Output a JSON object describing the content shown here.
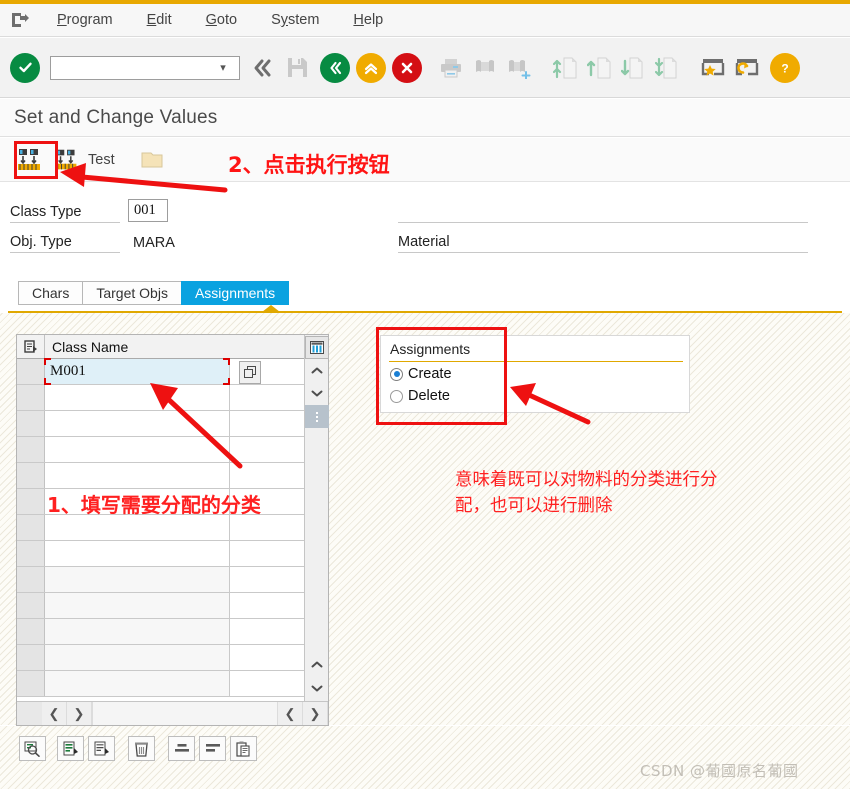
{
  "window": {
    "icon": "window-exit-icon",
    "accent_gold": "#e8a800"
  },
  "menubar": {
    "items": [
      {
        "label": "Program"
      },
      {
        "label": "Edit"
      },
      {
        "label": "Goto"
      },
      {
        "label": "System"
      },
      {
        "label": "Help"
      }
    ]
  },
  "system_toolbar": {
    "command_field": {
      "value": "",
      "placeholder": ""
    },
    "icons": [
      "enter-checkmark-icon",
      "back-double-chevron-icon",
      "save-disk-icon",
      "back-green-icon",
      "exit-up-icon",
      "cancel-x-icon",
      "print-icon",
      "find-icon",
      "find-next-icon",
      "first-page-icon",
      "previous-page-icon",
      "next-page-icon",
      "last-page-icon",
      "create-favorite-icon",
      "customize-local-layout-icon",
      "help-icon"
    ]
  },
  "title": {
    "text": "Set and Change Values"
  },
  "app_toolbar": {
    "execute_button": "execute-icon",
    "test_button_label": "Test",
    "folder_button": "folder-icon"
  },
  "form": {
    "fields": [
      {
        "label": "Class Type",
        "value": "001",
        "boxed": true
      },
      {
        "label": "Obj. Type",
        "value": "MARA",
        "boxed": false
      }
    ],
    "right_field": {
      "label": "Material",
      "value": ""
    }
  },
  "tabs": [
    {
      "label": "Chars",
      "active": false
    },
    {
      "label": "Target Objs",
      "active": false
    },
    {
      "label": "Assignments",
      "active": true
    }
  ],
  "table": {
    "columns": [
      "Class Name"
    ],
    "select_all_icon": "select-all-icon",
    "rows": [
      {
        "value": "M001",
        "focused": true
      },
      {
        "value": "",
        "focused": false
      },
      {
        "value": "",
        "focused": false
      },
      {
        "value": "",
        "focused": false
      },
      {
        "value": "",
        "focused": false
      },
      {
        "value": "",
        "focused": false
      },
      {
        "value": "",
        "focused": false
      },
      {
        "value": "",
        "focused": false
      },
      {
        "value": "",
        "focused": false
      },
      {
        "value": "",
        "focused": false
      },
      {
        "value": "",
        "focused": false
      },
      {
        "value": "",
        "focused": false
      },
      {
        "value": "",
        "focused": false
      }
    ],
    "popup_button": "value-help-popup-icon",
    "rail": {
      "config_icon": "table-settings-icon",
      "up_icon": "scroll-up-icon",
      "down_icon": "scroll-down-icon",
      "grip_icon": "scroll-grip-icon",
      "bottom_up_icon": "scroll-up-icon",
      "bottom_down_icon": "scroll-down-icon"
    },
    "hscroll": {
      "left_icon": "scroll-left-icon",
      "right_icon": "scroll-right-icon",
      "left_icon_2": "scroll-left-icon",
      "right_icon_2": "scroll-right-icon"
    }
  },
  "assignments_group": {
    "title": "Assignments",
    "options": [
      {
        "label": "Create",
        "selected": true
      },
      {
        "label": "Delete",
        "selected": false
      }
    ]
  },
  "annotations": {
    "step1": "1、填写需要分配的分类",
    "step2": "2、点击执行按钮",
    "note": "意味着既可以对物料的分类进行分\n配，也可以进行删除",
    "color": "#ff2020"
  },
  "bottom_toolbar": {
    "buttons": [
      "find-in-table-icon",
      "insert-row-icon",
      "append-row-icon",
      "delete-row-icon",
      "sort-ascending-icon",
      "sort-descending-icon",
      "paste-clipboard-icon"
    ]
  },
  "watermark": {
    "text": "CSDN @葡國原名葡國"
  }
}
